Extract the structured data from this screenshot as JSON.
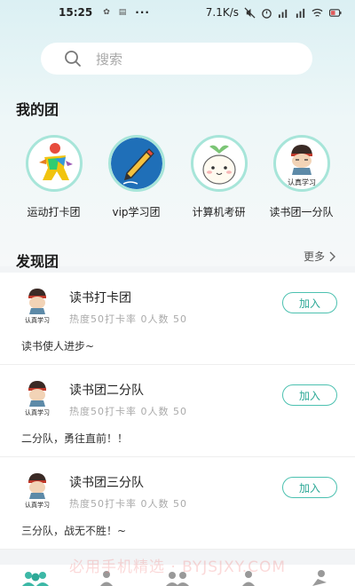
{
  "status_bar": {
    "time": "15:25",
    "speed": "7.1K/s",
    "battery": "45"
  },
  "search": {
    "placeholder": "搜索"
  },
  "my_groups": {
    "title": "我的团",
    "items": [
      {
        "name": "运动打卡团",
        "icon": "runner-avatar"
      },
      {
        "name": "vip学习团",
        "icon": "pencil-avatar"
      },
      {
        "name": "计算机考研",
        "icon": "cartoon-sprout-avatar"
      },
      {
        "name": "读书团一分队",
        "icon": "study-boy-avatar",
        "caption": "认真学习"
      }
    ]
  },
  "discover": {
    "title": "发现团",
    "more_label": "更多",
    "join_label": "加入",
    "thumb_caption": "认真学习",
    "items": [
      {
        "name": "读书打卡团",
        "stats": "热度50打卡率 0人数 50",
        "desc": "读书使人进步~"
      },
      {
        "name": "读书团二分队",
        "stats": "热度50打卡率 0人数 50",
        "desc": "二分队，勇往直前！！"
      },
      {
        "name": "读书团三分队",
        "stats": "热度50打卡率 0人数 50",
        "desc": "三分队，战无不胜！~"
      }
    ]
  },
  "watermark": "必用手机精选 · BYJSJXY.COM",
  "colors": {
    "accent": "#2ea997",
    "ring": "#a7e5d9",
    "background": "#f2f4f6"
  }
}
